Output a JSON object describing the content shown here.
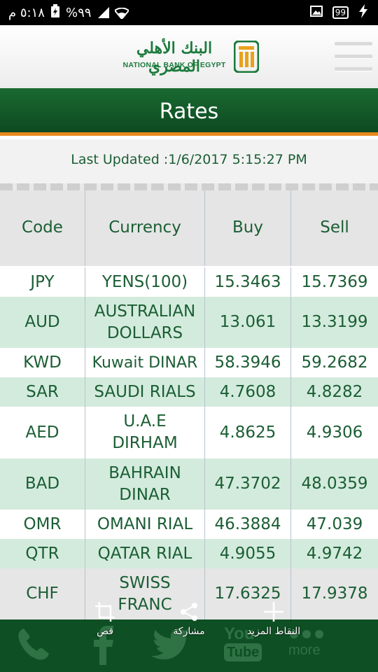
{
  "status_bar": {
    "time": "٥:١٨ م",
    "battery": "%٩٩",
    "icons": [
      "battery-charging-icon",
      "signal-icon",
      "wifi-icon",
      "image-icon",
      "hd-icon",
      "charging-bolt-icon"
    ],
    "hd_label": "99"
  },
  "header": {
    "logo_arabic": "البنك الأهلي المصري",
    "logo_english": "NATIONAL BANK OF EGYPT",
    "menu_icon": "hamburger-menu-icon"
  },
  "title": "Rates",
  "last_updated": "Last Updated :1/6/2017 5:15:27 PM",
  "table": {
    "headers": [
      "Code",
      "Currency",
      "Buy",
      "Sell"
    ],
    "rows": [
      {
        "code": "JPY",
        "currency": "YENS(100)",
        "buy": "15.3463",
        "sell": "15.7369"
      },
      {
        "code": "AUD",
        "currency": "AUSTRALIAN DOLLARS",
        "buy": "13.061",
        "sell": "13.3199"
      },
      {
        "code": "KWD",
        "currency": "Kuwait DINAR",
        "buy": "58.3946",
        "sell": "59.2682"
      },
      {
        "code": "SAR",
        "currency": "SAUDI RIALS",
        "buy": "4.7608",
        "sell": "4.8282"
      },
      {
        "code": "AED",
        "currency": "U.A.E DIRHAM",
        "buy": "4.8625",
        "sell": "4.9306"
      },
      {
        "code": "BAD",
        "currency": "BAHRAIN DINAR",
        "buy": "47.3702",
        "sell": "48.0359"
      },
      {
        "code": "OMR",
        "currency": "OMANI RIAL",
        "buy": "46.3884",
        "sell": "47.039"
      },
      {
        "code": "QTR",
        "currency": "QATAR RIAL",
        "buy": "4.9055",
        "sell": "4.9742"
      },
      {
        "code": "CHF",
        "currency": "SWISS FRANC",
        "buy": "17.6325",
        "sell": "17.9378"
      }
    ]
  },
  "bottom_nav": {
    "icons": [
      "phone-icon",
      "facebook-icon",
      "twitter-icon",
      "youtube-icon",
      "more-icon"
    ],
    "youtube_label_top": "You",
    "youtube_label_bottom": "Tube",
    "more_label": "more"
  },
  "overlay_toolbar": {
    "crop_label": "قص",
    "share_label": "مشاركة",
    "more_points_label": "النقاط المزيد"
  },
  "colors": {
    "brand_green": "#1b5e34",
    "title_green": "#0d4a21",
    "accent_orange": "#e8891c",
    "row_mint": "#d3ebdd"
  }
}
